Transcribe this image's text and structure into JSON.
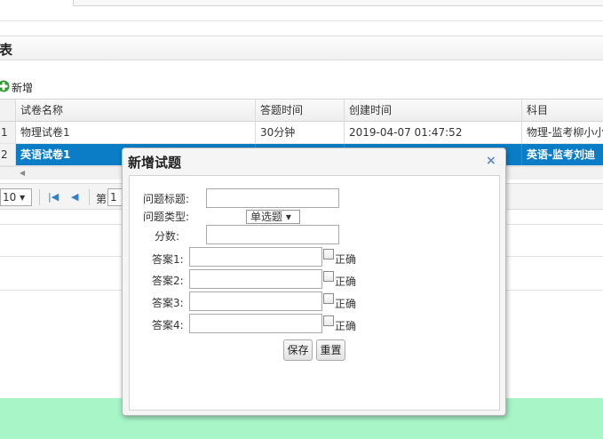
{
  "panel": {
    "title": "表"
  },
  "toolbar": {
    "add_label": "新增"
  },
  "grid": {
    "columns": [
      "试卷名称",
      "答题时间",
      "创建时间",
      "科目"
    ],
    "rows": [
      {
        "num": "1",
        "name": "物理试卷1",
        "time": "30分钟",
        "created": "2019-04-07 01:47:52",
        "subject": "物理-监考柳小小"
      },
      {
        "num": "2",
        "name": "英语试卷1",
        "time": "",
        "created": "",
        "subject": "英语-监考刘迪"
      }
    ]
  },
  "pager": {
    "page_size": "10",
    "page_label": "第",
    "page_value": "1"
  },
  "dialog": {
    "title": "新增试题",
    "close": "×",
    "fields": {
      "question_title": "问题标题:",
      "question_type": "问题类型:",
      "question_type_value": "单选题",
      "score": "分数:"
    },
    "answers": [
      {
        "label": "答案1:",
        "correct": "正确"
      },
      {
        "label": "答案2:",
        "correct": "正确"
      },
      {
        "label": "答案3:",
        "correct": "正确"
      },
      {
        "label": "答案4:",
        "correct": "正确"
      }
    ],
    "save_label": "保存",
    "reset_label": "重置"
  }
}
